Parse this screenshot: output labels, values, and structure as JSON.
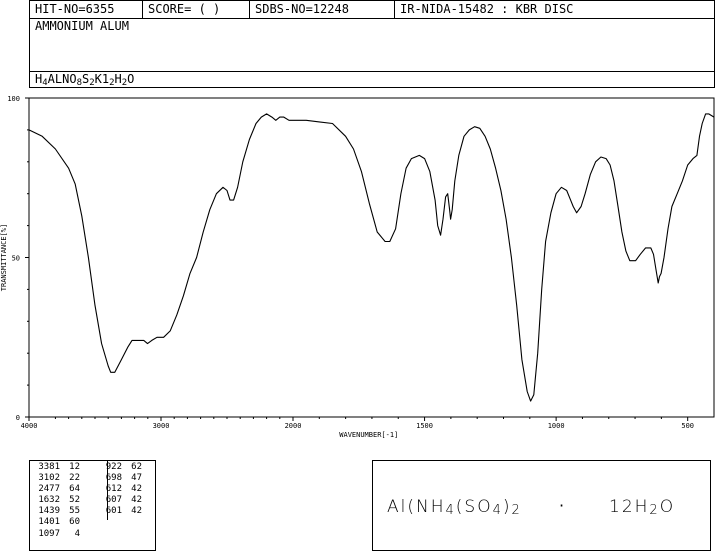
{
  "header": {
    "hit_no": "HIT-NO=6355",
    "score": "SCORE=  (   )",
    "sdbs_no": "SDBS-NO=12248",
    "ir_info": "IR-NIDA-15482 : KBR DISC",
    "compound_name": "AMMONIUM ALUM",
    "formula_parts": [
      {
        "t": "H",
        "sub": false
      },
      {
        "t": "4",
        "sub": true
      },
      {
        "t": "ALNO",
        "sub": false
      },
      {
        "t": "8",
        "sub": true
      },
      {
        "t": "S",
        "sub": false
      },
      {
        "t": "2",
        "sub": true
      },
      {
        "t": "K1",
        "sub": false
      },
      {
        "t": "2",
        "sub": true
      },
      {
        "t": "H",
        "sub": false
      },
      {
        "t": "2",
        "sub": true
      },
      {
        "t": "O",
        "sub": false
      }
    ]
  },
  "chart_data": {
    "type": "line",
    "xlabel": "WAVENUMBER[-1]",
    "ylabel": "TRANSMITTANCE[%]",
    "xlim": [
      4000,
      400
    ],
    "ylim": [
      0,
      100
    ],
    "x_ticks": [
      4000,
      3000,
      2000,
      1500,
      1000,
      500
    ],
    "x_tick_labels": [
      "4000",
      "3000",
      "2000",
      "1500",
      "1000",
      "500"
    ],
    "y_ticks": [
      0,
      50,
      100
    ],
    "y_tick_labels": [
      "0",
      "50",
      "100"
    ],
    "x_scale": "piecewise-linear, compressed above 2000",
    "series": [
      {
        "points": [
          [
            4000,
            90
          ],
          [
            3900,
            88
          ],
          [
            3800,
            84
          ],
          [
            3700,
            78
          ],
          [
            3650,
            73
          ],
          [
            3600,
            63
          ],
          [
            3550,
            50
          ],
          [
            3500,
            35
          ],
          [
            3450,
            23
          ],
          [
            3400,
            16
          ],
          [
            3381,
            14
          ],
          [
            3350,
            14
          ],
          [
            3300,
            18
          ],
          [
            3250,
            22
          ],
          [
            3220,
            24
          ],
          [
            3180,
            24
          ],
          [
            3130,
            24
          ],
          [
            3102,
            23
          ],
          [
            3070,
            24
          ],
          [
            3030,
            25
          ],
          [
            2980,
            25
          ],
          [
            2930,
            27
          ],
          [
            2880,
            32
          ],
          [
            2830,
            38
          ],
          [
            2780,
            45
          ],
          [
            2730,
            50
          ],
          [
            2680,
            58
          ],
          [
            2630,
            65
          ],
          [
            2580,
            70
          ],
          [
            2530,
            72
          ],
          [
            2500,
            71
          ],
          [
            2477,
            68
          ],
          [
            2450,
            68
          ],
          [
            2420,
            72
          ],
          [
            2380,
            80
          ],
          [
            2330,
            87
          ],
          [
            2280,
            92
          ],
          [
            2240,
            94
          ],
          [
            2200,
            95
          ],
          [
            2160,
            94
          ],
          [
            2130,
            93
          ],
          [
            2100,
            94
          ],
          [
            2070,
            94
          ],
          [
            2030,
            93
          ],
          [
            2000,
            93
          ],
          [
            1950,
            93
          ],
          [
            1900,
            92.5
          ],
          [
            1850,
            92
          ],
          [
            1800,
            88
          ],
          [
            1770,
            84
          ],
          [
            1740,
            77
          ],
          [
            1710,
            67
          ],
          [
            1680,
            58
          ],
          [
            1650,
            55
          ],
          [
            1632,
            55
          ],
          [
            1610,
            59
          ],
          [
            1590,
            70
          ],
          [
            1570,
            78
          ],
          [
            1550,
            81
          ],
          [
            1520,
            82
          ],
          [
            1500,
            81
          ],
          [
            1480,
            77
          ],
          [
            1460,
            68
          ],
          [
            1450,
            60
          ],
          [
            1439,
            57
          ],
          [
            1430,
            62
          ],
          [
            1420,
            69
          ],
          [
            1412,
            70
          ],
          [
            1405,
            65
          ],
          [
            1401,
            62
          ],
          [
            1395,
            65
          ],
          [
            1385,
            74
          ],
          [
            1370,
            82
          ],
          [
            1350,
            88
          ],
          [
            1330,
            90
          ],
          [
            1310,
            91
          ],
          [
            1290,
            90.5
          ],
          [
            1270,
            88
          ],
          [
            1250,
            84
          ],
          [
            1230,
            78
          ],
          [
            1210,
            71
          ],
          [
            1190,
            62
          ],
          [
            1170,
            50
          ],
          [
            1150,
            35
          ],
          [
            1130,
            18
          ],
          [
            1110,
            8
          ],
          [
            1097,
            5
          ],
          [
            1085,
            7
          ],
          [
            1070,
            20
          ],
          [
            1055,
            40
          ],
          [
            1040,
            55
          ],
          [
            1020,
            64
          ],
          [
            1000,
            70
          ],
          [
            980,
            72
          ],
          [
            960,
            71
          ],
          [
            945,
            68
          ],
          [
            935,
            66
          ],
          [
            922,
            64
          ],
          [
            905,
            66
          ],
          [
            890,
            70
          ],
          [
            870,
            76
          ],
          [
            850,
            80
          ],
          [
            830,
            81.5
          ],
          [
            810,
            81
          ],
          [
            795,
            79
          ],
          [
            780,
            74
          ],
          [
            765,
            66
          ],
          [
            750,
            58
          ],
          [
            735,
            52
          ],
          [
            720,
            49
          ],
          [
            698,
            49
          ],
          [
            680,
            51
          ],
          [
            660,
            53
          ],
          [
            640,
            53
          ],
          [
            630,
            51
          ],
          [
            620,
            46
          ],
          [
            612,
            42
          ],
          [
            607,
            44
          ],
          [
            601,
            45
          ],
          [
            590,
            50
          ],
          [
            575,
            59
          ],
          [
            560,
            66
          ],
          [
            540,
            70
          ],
          [
            520,
            74
          ],
          [
            500,
            79
          ],
          [
            480,
            81
          ],
          [
            465,
            82
          ],
          [
            455,
            88
          ],
          [
            445,
            92
          ],
          [
            432,
            95
          ],
          [
            420,
            95
          ],
          [
            400,
            94
          ]
        ]
      }
    ]
  },
  "peak_table": {
    "columns": [
      [
        [
          "3381",
          "12"
        ],
        [
          "3102",
          "22"
        ],
        [
          "2477",
          "64"
        ],
        [
          "1632",
          "52"
        ],
        [
          "1439",
          "55"
        ],
        [
          "1401",
          "60"
        ],
        [
          "1097",
          "4"
        ]
      ],
      [
        [
          "922",
          "62"
        ],
        [
          "698",
          "47"
        ],
        [
          "612",
          "42"
        ],
        [
          "607",
          "42"
        ],
        [
          "601",
          "42"
        ]
      ]
    ]
  },
  "structure": {
    "parts": [
      {
        "t": "Al(NH",
        "sub": false
      },
      {
        "t": "4",
        "sub": true
      },
      {
        "t": "(SO",
        "sub": false
      },
      {
        "t": "4",
        "sub": true
      },
      {
        "t": ")",
        "sub": false
      },
      {
        "t": "2",
        "sub": true
      }
    ],
    "dot": "·",
    "water_parts": [
      {
        "t": "12H",
        "sub": false
      },
      {
        "t": "2",
        "sub": true
      },
      {
        "t": "O",
        "sub": false
      }
    ]
  }
}
